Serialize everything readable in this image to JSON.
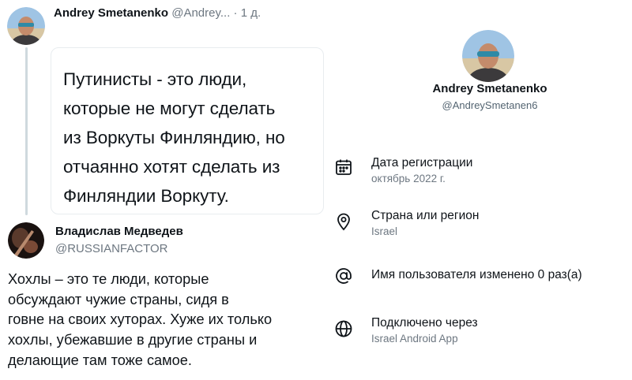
{
  "tweet1": {
    "author_name": "Andrey Smetanenko",
    "author_handle": "@Andrey...",
    "dot": "·",
    "time": "1 д.",
    "quote_lines": [
      "Путинисты - это люди,",
      "которые не могут сделать",
      "из Воркуты Финляндию, но",
      "отчаянно хотят сделать из",
      "Финляндии Воркуту."
    ]
  },
  "tweet2": {
    "author_name": "Владислав Медведев",
    "author_handle": "@RUSSIANFACTOR",
    "text_lines": [
      "Хохлы – это те люди, которые",
      "обсуждают чужие страны, сидя в",
      "говне на своих хуторах. Хуже их только",
      "хохлы, убежавшие в другие страны и",
      "делающие там тоже самое."
    ]
  },
  "profile": {
    "name": "Andrey Smetanenko",
    "handle": "@AndreySmetanen6",
    "info": [
      {
        "icon": "calendar-icon",
        "title": "Дата регистрации",
        "sub": "октябрь 2022 г."
      },
      {
        "icon": "location-pin-icon",
        "title": "Страна или регион",
        "sub": "Israel"
      },
      {
        "icon": "at-sign-icon",
        "title": "Имя пользователя изменено 0 раз(а)",
        "sub": ""
      },
      {
        "icon": "globe-icon",
        "title": "Подключено через",
        "sub": "Israel Android App"
      }
    ]
  },
  "colors": {
    "text_primary": "#0f1419",
    "text_secondary": "#6d7781",
    "thread_line": "#cfd9de",
    "card_border": "#e8ecef"
  }
}
